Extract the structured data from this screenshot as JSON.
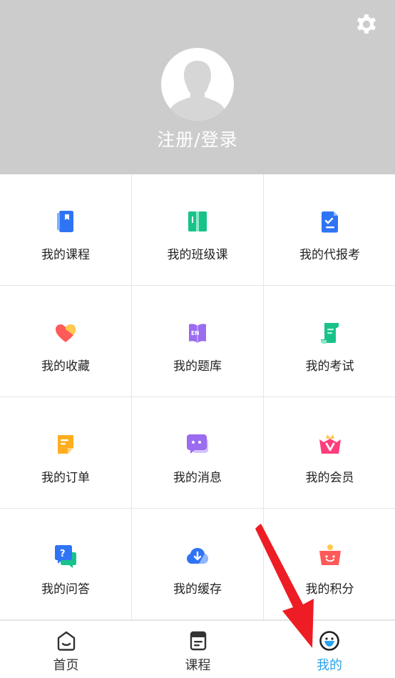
{
  "header": {
    "login_label": "注册/登录",
    "settings_icon": "gear-icon",
    "avatar_icon": "default-avatar-icon",
    "background": "#cccccc"
  },
  "menu": {
    "items": [
      {
        "label": "我的课程",
        "icon": "course-book-icon"
      },
      {
        "label": "我的班级课",
        "icon": "class-book-icon"
      },
      {
        "label": "我的代报考",
        "icon": "exam-registration-icon"
      },
      {
        "label": "我的收藏",
        "icon": "heart-icon"
      },
      {
        "label": "我的题库",
        "icon": "question-bank-icon"
      },
      {
        "label": "我的考试",
        "icon": "exam-scroll-icon"
      },
      {
        "label": "我的订单",
        "icon": "order-note-icon"
      },
      {
        "label": "我的消息",
        "icon": "message-bubble-icon"
      },
      {
        "label": "我的会员",
        "icon": "vip-crown-icon"
      },
      {
        "label": "我的问答",
        "icon": "qa-bubble-icon"
      },
      {
        "label": "我的缓存",
        "icon": "cloud-download-icon"
      },
      {
        "label": "我的积分",
        "icon": "points-gift-icon"
      }
    ]
  },
  "tabbar": {
    "tabs": [
      {
        "label": "首页",
        "icon": "home-icon",
        "active": false
      },
      {
        "label": "课程",
        "icon": "course-list-icon",
        "active": false
      },
      {
        "label": "我的",
        "icon": "profile-smile-icon",
        "active": true
      }
    ],
    "active_color": "#2aa3ea"
  },
  "annotation": {
    "icon": "red-arrow-icon",
    "color": "#ee1c24"
  }
}
